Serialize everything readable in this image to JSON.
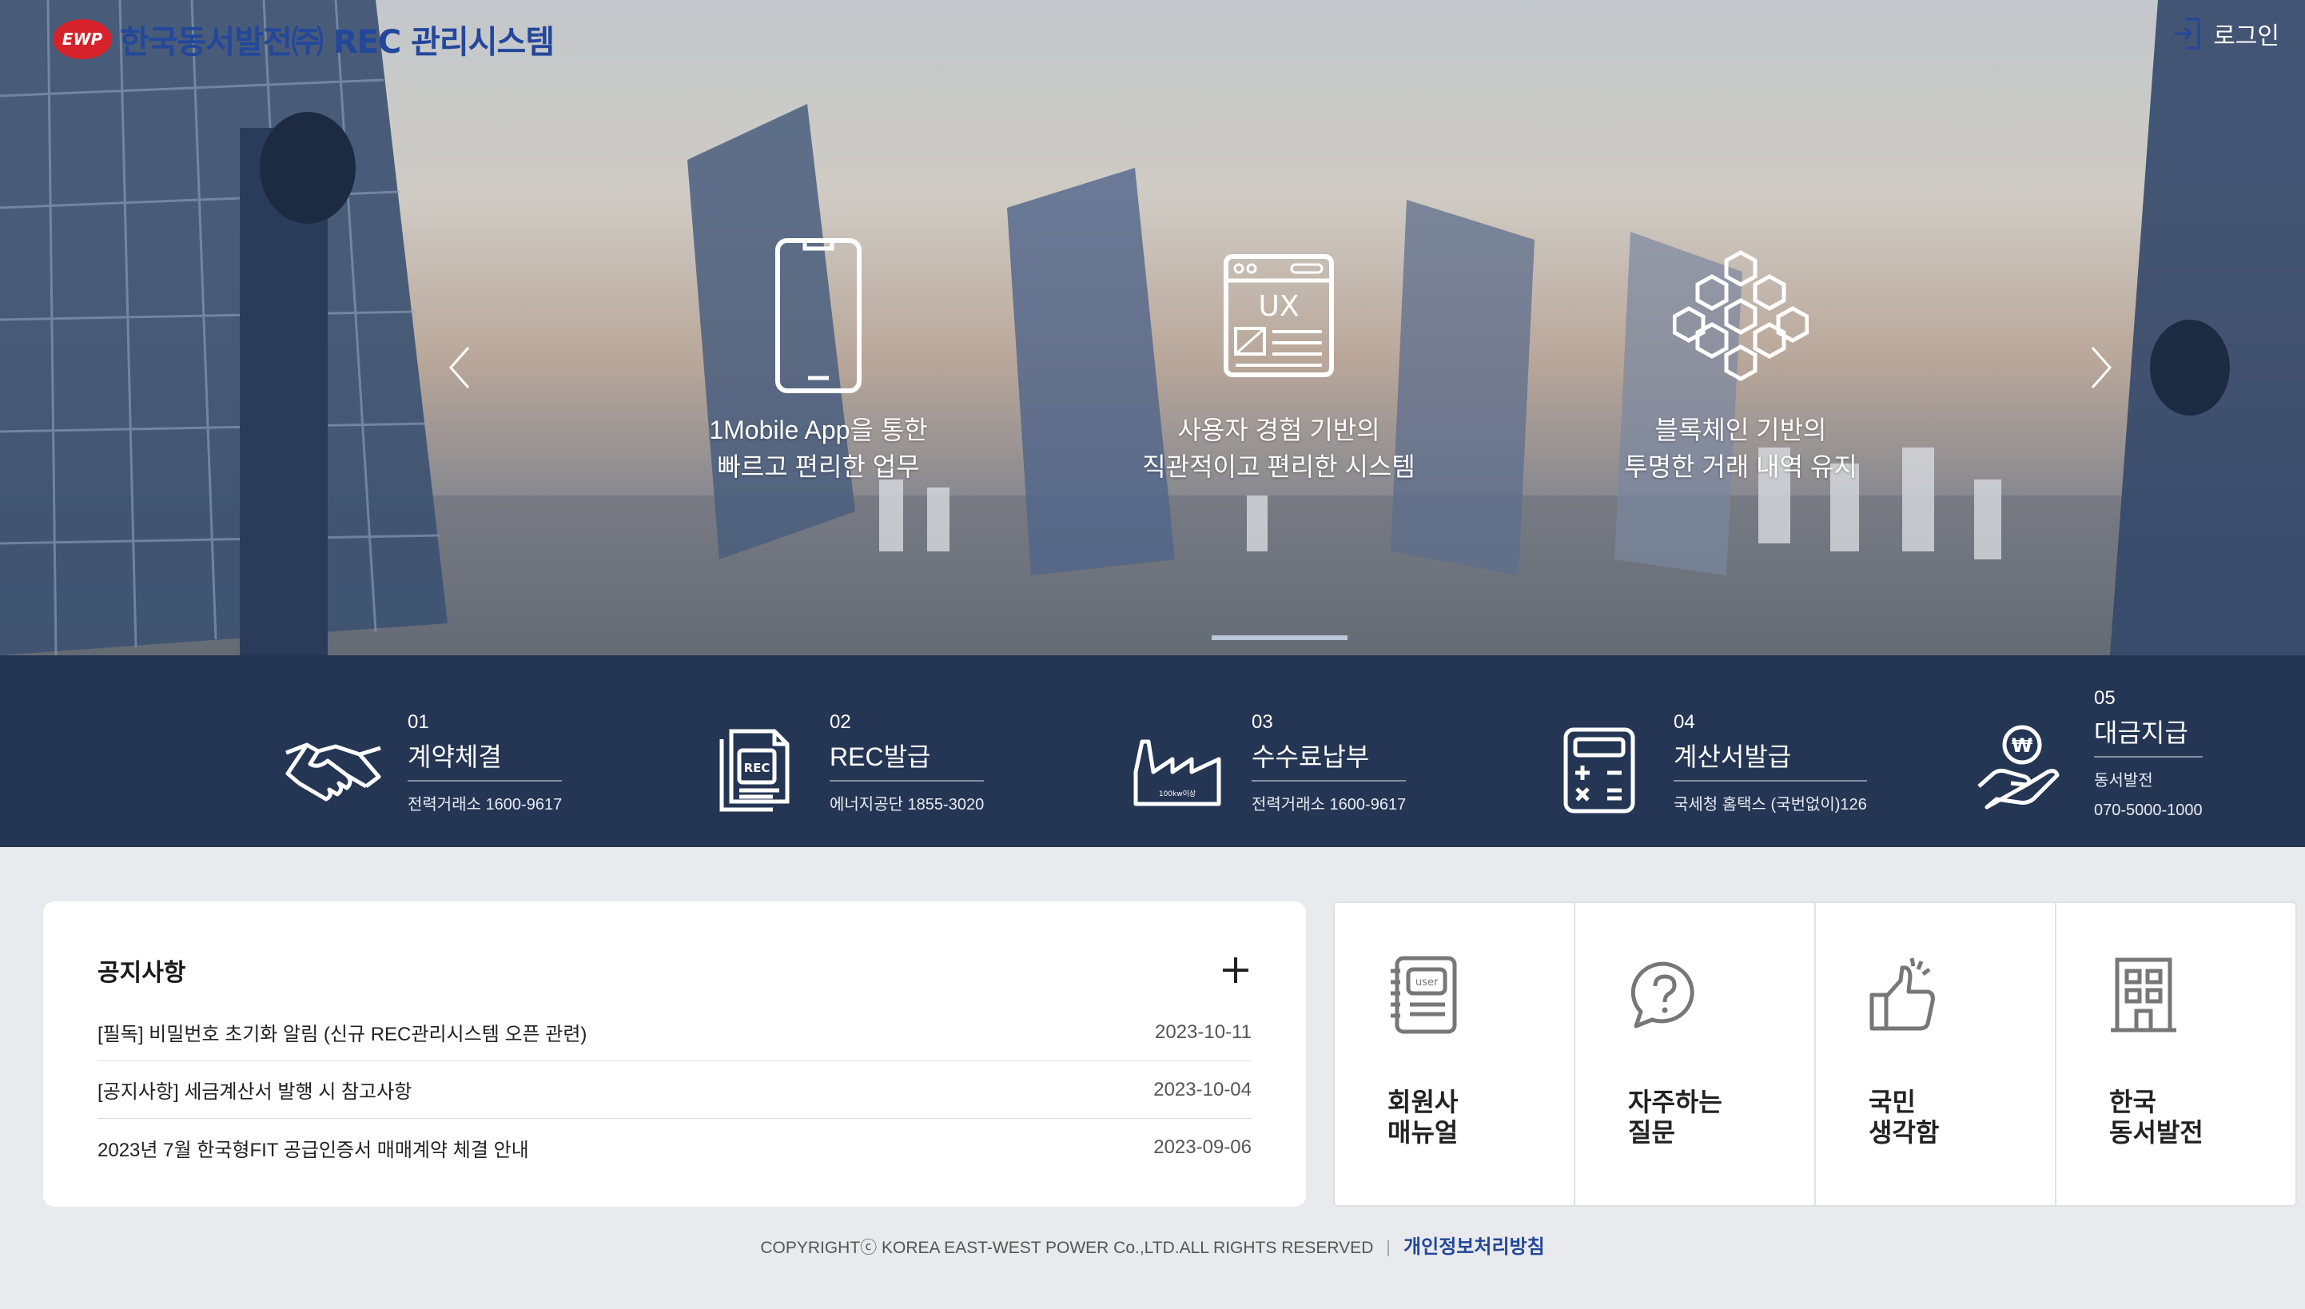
{
  "header": {
    "logo_mark": "EWP",
    "logo_text": "한국동서발전㈜ REC 관리시스템",
    "login_label": "로그인"
  },
  "hero": {
    "features": [
      {
        "line1": "1Mobile App을 통한",
        "line2": "빠르고 편리한 업무",
        "icon": "smartphone-icon"
      },
      {
        "line1": "사용자 경험 기반의",
        "line2": "직관적이고 편리한 시스템",
        "icon": "ux-window-icon",
        "icon_text": "UX"
      },
      {
        "line1": "블록체인 기반의",
        "line2": "투명한 거래 내역 유지",
        "icon": "blockchain-cubes-icon"
      }
    ]
  },
  "services": [
    {
      "num": "01",
      "name": "계약체결",
      "sub": "전력거래소 1600-9617",
      "icon": "handshake-icon"
    },
    {
      "num": "02",
      "name": "REC발급",
      "sub": "에너지공단 1855-3020",
      "icon": "rec-document-icon",
      "icon_text": "REC"
    },
    {
      "num": "03",
      "name": "수수료납부",
      "sub": "전력거래소 1600-9617",
      "icon": "factory-icon",
      "icon_text": "100kw이상"
    },
    {
      "num": "04",
      "name": "계산서발급",
      "sub": "국세청 홈택스 (국번없이)126",
      "icon": "calculator-icon"
    },
    {
      "num": "05",
      "name": "대금지급",
      "sub": "동서발전",
      "phone": "070-5000-1000",
      "icon": "won-hand-icon",
      "icon_text": "₩"
    }
  ],
  "notice": {
    "title": "공지사항",
    "items": [
      {
        "title": "[필독] 비밀번호 초기화 알림 (신규 REC관리시스템 오픈 관련)",
        "date": "2023-10-11"
      },
      {
        "title": "[공지사항] 세금계산서 발행 시 참고사항",
        "date": "2023-10-04"
      },
      {
        "title": "2023년 7월 한국형FIT 공급인증서 매매계약 체결 안내",
        "date": "2023-09-06"
      }
    ]
  },
  "quick_menu": [
    {
      "label": "회원사\n매뉴얼",
      "icon": "user-manual-icon",
      "icon_text": "user"
    },
    {
      "label": "자주하는\n질문",
      "icon": "question-bubble-icon"
    },
    {
      "label": "국민\n생각함",
      "icon": "thumbs-up-icon"
    },
    {
      "label": "한국\n동서발전",
      "icon": "building-icon"
    }
  ],
  "footer": {
    "copyright": "COPYRIGHTⓒ KOREA EAST-WEST POWER Co.,LTD.ALL RIGHTS RESERVED",
    "privacy": "개인정보처리방침"
  },
  "colors": {
    "band_bg": "#253654",
    "brand_blue": "#23479a",
    "brand_red": "#d6222a",
    "page_bg": "#e9eaee"
  }
}
